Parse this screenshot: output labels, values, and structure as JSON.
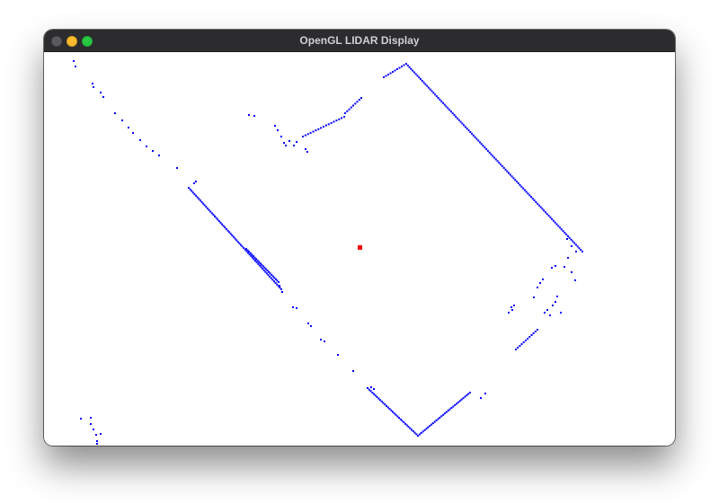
{
  "window": {
    "title": "OpenGL LIDAR Display"
  },
  "colors": {
    "scan_point": "#0000ff",
    "sensor_origin": "#ff0000",
    "background": "#ffffff",
    "titlebar": "#2c2c2e"
  },
  "icons": {
    "close": "close-icon",
    "minimize": "minimize-icon",
    "maximize": "maximize-icon"
  }
}
